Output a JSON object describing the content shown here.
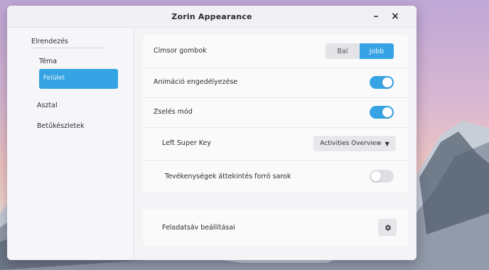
{
  "window": {
    "title": "Zorin Appearance",
    "minimize_icon": "minimize-icon",
    "close_icon": "close-icon"
  },
  "sidebar": {
    "items": [
      {
        "label": "Elrendezés"
      },
      {
        "label": "Téma"
      },
      {
        "label": "Felület",
        "selected": true
      },
      {
        "label": "Asztal"
      },
      {
        "label": "Betűkészletek"
      }
    ]
  },
  "settings": {
    "title_buttons": {
      "label": "Címsor gombok",
      "options": [
        "Bal",
        "Jobb"
      ],
      "selected": "Jobb"
    },
    "animations": {
      "label": "Animáció engedélyezése",
      "enabled": true
    },
    "jelly": {
      "label": "Zselés mód",
      "enabled": true
    },
    "super_key": {
      "label": "Left Super Key",
      "value": "Activities Overview"
    },
    "hot_corner": {
      "label": "Tevékenységek áttekintés forró sarok",
      "enabled": false
    },
    "taskbar": {
      "label": "Feladatsáv beállításai",
      "icon": "gear-icon"
    }
  },
  "colors": {
    "accent": "#35a3e4"
  }
}
